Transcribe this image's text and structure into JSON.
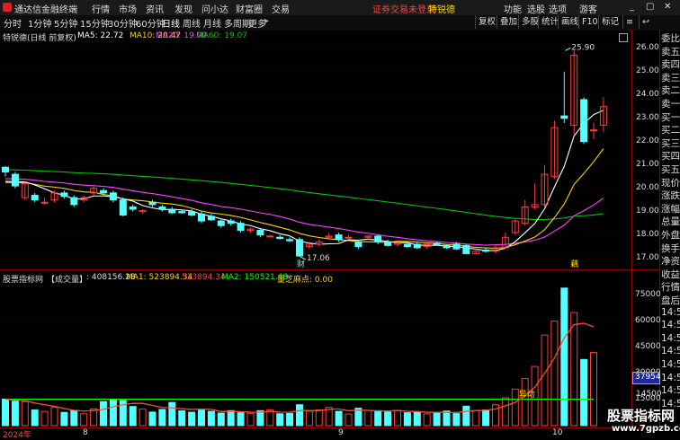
{
  "app": {
    "title": "通达信金融终端",
    "menu": [
      "行情",
      "市场",
      "资讯",
      "发现",
      "问小达",
      "财富圈",
      "交易"
    ],
    "notice": "证券交易未登录",
    "stock_name": "特锐德",
    "right_menu": [
      "功能",
      "选股",
      "选项",
      "游客"
    ],
    "window_controls": [
      "_",
      "▢",
      "✕"
    ]
  },
  "toolbar": {
    "periods": [
      "分时",
      "1分钟",
      "5分钟",
      "15分钟",
      "30分钟",
      "60分钟",
      "日线",
      "周线",
      "月线",
      "多周期",
      "更多"
    ],
    "active": "日线",
    "more_arrow": "▸",
    "right_buttons": [
      "复权",
      "叠加",
      "多股",
      "统计",
      "画线",
      "F10",
      "标记"
    ],
    "right_icons": [
      "≡",
      "↩"
    ]
  },
  "main_info": {
    "title": "特锐德(日线 前复权)",
    "ma5": "MA5: 22.72",
    "ma10": "MA10: 20.47",
    "ma20": "MA20: 19.00",
    "ma60": "MA60: 19.07"
  },
  "sub_info": {
    "title": "股票指标网",
    "indicator": "【成交量】",
    "vol": ": 408156.28",
    "ma1": "MA1: 523894.34",
    "ma1b": "523894.34",
    "ma2": "MA2: 150521.48",
    "lbl": "量芝麻点: 0.00"
  },
  "main_annotations": {
    "high": "25.90",
    "low": "17.06",
    "marker_cai": "财",
    "marker_hong": "藕"
  },
  "sub_annotations": {
    "tag": "异动",
    "current_vol": "37954"
  },
  "price_axis": [
    "26.00",
    "25.00",
    "24.00",
    "23.00",
    "22.00",
    "21.00",
    "20.00",
    "19.00",
    "18.00",
    "17.00"
  ],
  "volume_axis": [
    "75000",
    "60000",
    "45000",
    "30000",
    "15000"
  ],
  "vol_axis_extras": [
    "14500"
  ],
  "date_axis": [
    "2024年",
    "8",
    "9",
    "10"
  ],
  "sidebar": [
    "委比",
    "卖五",
    "卖四",
    "卖三",
    "卖二",
    "卖一",
    "买一",
    "买二",
    "买三",
    "买四",
    "买五",
    "现价",
    "涨跌",
    "涨幅",
    "总量",
    "外盘",
    "换手",
    "净资",
    "收益",
    "行情",
    "盘后",
    "14:50",
    "14:50",
    "14:50",
    "14:50",
    "14:50",
    "14:50",
    "14:50",
    "14:51"
  ],
  "watermark": {
    "main": "股票指标网",
    "url": "www.7gpzb.com"
  },
  "colors": {
    "up": "#ff3b3b",
    "down": "#54ffff",
    "ma5": "#ffffff",
    "ma10": "#ffd400",
    "ma20": "#ff40ff",
    "ma60": "#00c800",
    "vol_ma2": "#00ff00",
    "grid_red": "#8b0000"
  },
  "chart_data": {
    "type": "candlestick",
    "title": "特锐德(日线 前复权)",
    "ylim": [
      16.6,
      26.3
    ],
    "candles": [
      {
        "o": 20.9,
        "c": 20.7,
        "h": 20.95,
        "l": 20.5
      },
      {
        "o": 20.6,
        "c": 20.1,
        "h": 20.7,
        "l": 20.0
      },
      {
        "o": 19.6,
        "c": 20.2,
        "h": 20.3,
        "l": 19.5
      },
      {
        "o": 19.7,
        "c": 19.5,
        "h": 19.8,
        "l": 19.4
      },
      {
        "o": 19.4,
        "c": 19.4,
        "h": 19.6,
        "l": 19.3
      },
      {
        "o": 19.5,
        "c": 19.8,
        "h": 19.9,
        "l": 19.4
      },
      {
        "o": 19.8,
        "c": 19.65,
        "h": 19.9,
        "l": 19.55
      },
      {
        "o": 19.6,
        "c": 19.3,
        "h": 19.7,
        "l": 19.2
      },
      {
        "o": 19.5,
        "c": 19.6,
        "h": 19.7,
        "l": 19.4
      },
      {
        "o": 19.8,
        "c": 20.0,
        "h": 20.1,
        "l": 19.7
      },
      {
        "o": 19.9,
        "c": 19.8,
        "h": 20.0,
        "l": 19.7
      },
      {
        "o": 19.8,
        "c": 19.5,
        "h": 19.9,
        "l": 19.4
      },
      {
        "o": 19.5,
        "c": 18.85,
        "h": 19.6,
        "l": 18.8
      },
      {
        "o": 19.2,
        "c": 19.1,
        "h": 19.3,
        "l": 19.0
      },
      {
        "o": 19.0,
        "c": 19.05,
        "h": 19.1,
        "l": 18.9
      },
      {
        "o": 19.4,
        "c": 19.3,
        "h": 19.5,
        "l": 19.2
      },
      {
        "o": 19.2,
        "c": 19.1,
        "h": 19.3,
        "l": 19.0
      },
      {
        "o": 19.1,
        "c": 18.95,
        "h": 19.2,
        "l": 18.9
      },
      {
        "o": 19.0,
        "c": 18.95,
        "h": 19.1,
        "l": 18.9
      },
      {
        "o": 19.0,
        "c": 18.85,
        "h": 19.1,
        "l": 18.8
      },
      {
        "o": 18.9,
        "c": 18.6,
        "h": 19.0,
        "l": 18.5
      },
      {
        "o": 18.8,
        "c": 18.65,
        "h": 18.9,
        "l": 18.6
      },
      {
        "o": 18.6,
        "c": 18.4,
        "h": 18.7,
        "l": 18.3
      },
      {
        "o": 18.6,
        "c": 18.5,
        "h": 18.7,
        "l": 18.4
      },
      {
        "o": 18.5,
        "c": 18.2,
        "h": 18.6,
        "l": 18.1
      },
      {
        "o": 18.2,
        "c": 18.25,
        "h": 18.3,
        "l": 18.1
      },
      {
        "o": 18.2,
        "c": 18.0,
        "h": 18.3,
        "l": 17.9
      },
      {
        "o": 17.95,
        "c": 17.95,
        "h": 18.0,
        "l": 17.9
      },
      {
        "o": 17.9,
        "c": 17.85,
        "h": 18.0,
        "l": 17.8
      },
      {
        "o": 17.8,
        "c": 17.75,
        "h": 17.9,
        "l": 17.7
      },
      {
        "o": 17.8,
        "c": 17.1,
        "h": 17.9,
        "l": 17.06
      },
      {
        "o": 17.5,
        "c": 17.6,
        "h": 17.7,
        "l": 17.4
      },
      {
        "o": 17.6,
        "c": 17.7,
        "h": 17.8,
        "l": 17.5
      },
      {
        "o": 17.9,
        "c": 17.95,
        "h": 18.1,
        "l": 17.8
      },
      {
        "o": 18.0,
        "c": 17.8,
        "h": 18.1,
        "l": 17.7
      },
      {
        "o": 17.9,
        "c": 17.9,
        "h": 18.0,
        "l": 17.8
      },
      {
        "o": 17.7,
        "c": 17.5,
        "h": 17.8,
        "l": 17.4
      },
      {
        "o": 17.9,
        "c": 17.95,
        "h": 18.0,
        "l": 17.8
      },
      {
        "o": 17.95,
        "c": 17.7,
        "h": 18.0,
        "l": 17.6
      },
      {
        "o": 17.7,
        "c": 17.55,
        "h": 17.8,
        "l": 17.5
      },
      {
        "o": 17.6,
        "c": 17.65,
        "h": 17.7,
        "l": 17.5
      },
      {
        "o": 17.6,
        "c": 17.5,
        "h": 17.7,
        "l": 17.45
      },
      {
        "o": 17.6,
        "c": 17.45,
        "h": 17.7,
        "l": 17.4
      },
      {
        "o": 17.5,
        "c": 17.6,
        "h": 17.7,
        "l": 17.4
      },
      {
        "o": 17.65,
        "c": 17.6,
        "h": 17.7,
        "l": 17.55
      },
      {
        "o": 17.55,
        "c": 17.45,
        "h": 17.6,
        "l": 17.4
      },
      {
        "o": 17.6,
        "c": 17.4,
        "h": 17.7,
        "l": 17.35
      },
      {
        "o": 17.55,
        "c": 17.2,
        "h": 17.6,
        "l": 17.2
      },
      {
        "o": 17.2,
        "c": 17.3,
        "h": 17.4,
        "l": 17.2
      },
      {
        "o": 17.35,
        "c": 17.3,
        "h": 17.45,
        "l": 17.25
      },
      {
        "o": 17.3,
        "c": 17.45,
        "h": 17.55,
        "l": 17.2
      },
      {
        "o": 17.45,
        "c": 17.9,
        "h": 18.1,
        "l": 17.4
      },
      {
        "o": 18.1,
        "c": 18.6,
        "h": 18.7,
        "l": 18.0
      },
      {
        "o": 18.5,
        "c": 19.2,
        "h": 19.5,
        "l": 18.4
      },
      {
        "o": 19.2,
        "c": 19.3,
        "h": 20.2,
        "l": 19.1
      },
      {
        "o": 19.3,
        "c": 20.6,
        "h": 21.0,
        "l": 19.2
      },
      {
        "o": 20.5,
        "c": 22.6,
        "h": 22.9,
        "l": 20.4
      },
      {
        "o": 23.1,
        "c": 23.0,
        "h": 25.0,
        "l": 22.8
      },
      {
        "o": 22.7,
        "c": 25.7,
        "h": 25.9,
        "l": 22.3
      },
      {
        "o": 23.8,
        "c": 22.0,
        "h": 23.9,
        "l": 21.9
      },
      {
        "o": 22.5,
        "c": 22.5,
        "h": 22.8,
        "l": 22.1
      },
      {
        "o": 22.7,
        "c": 23.5,
        "h": 23.9,
        "l": 22.4
      }
    ],
    "volume": {
      "ylim": [
        0,
        82000
      ],
      "values": [
        15200,
        14000,
        13800,
        9000,
        8200,
        10500,
        7600,
        8800,
        6800,
        9600,
        13800,
        15200,
        14500,
        11000,
        9500,
        7800,
        9300,
        13300,
        8500,
        7700,
        8900,
        8200,
        7200,
        8600,
        7400,
        7100,
        8600,
        9000,
        6800,
        7000,
        12000,
        8300,
        9000,
        10500,
        8200,
        6700,
        10000,
        8700,
        8600,
        7800,
        8600,
        7400,
        8000,
        6800,
        7500,
        8400,
        6900,
        11200,
        8700,
        9000,
        12000,
        16000,
        21000,
        27000,
        34000,
        52000,
        60000,
        79000,
        65000,
        38000,
        42000
      ]
    }
  }
}
